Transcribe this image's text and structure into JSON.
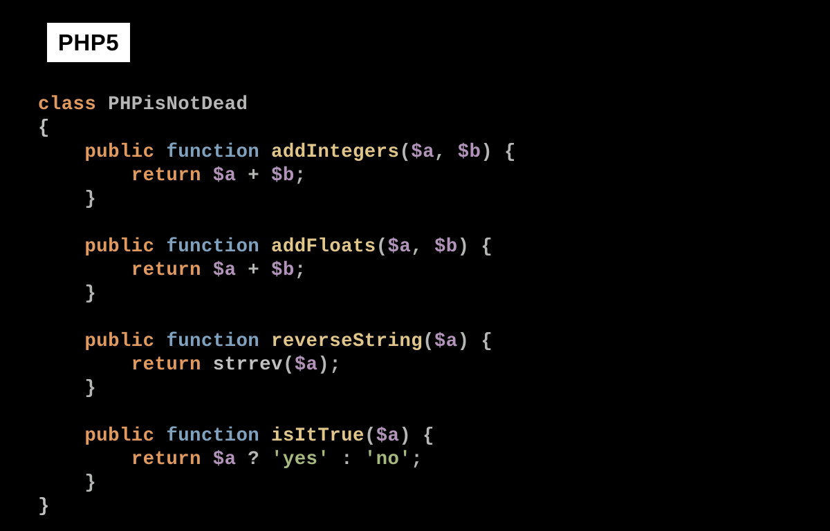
{
  "badge": "PHP5",
  "colors": {
    "background": "#000000",
    "keyword_orange": "#e09a5f",
    "keyword_blue": "#81a2be",
    "function_name": "#e1c68c",
    "identifier": "#b4b7b4",
    "variable": "#b294bb",
    "punctuation": "#b4b7b4",
    "text": "#bfc2bf",
    "string": "#a8b97f",
    "badge_bg": "#ffffff",
    "badge_fg": "#000000"
  },
  "code": {
    "class_kw": "class",
    "class_name": "PHPisNotDead",
    "open_brace": "{",
    "close_brace": "}",
    "public_kw": "public",
    "function_kw": "function",
    "return_kw": "return",
    "fn1_name": "addIntegers",
    "fn1_params_open": "(",
    "fn1_param_a": "$a",
    "fn1_comma": ",",
    "fn1_space": " ",
    "fn1_param_b": "$b",
    "fn1_params_close": ")",
    "fn1_body_open": " {",
    "fn1_ret_a": "$a",
    "fn1_plus": " + ",
    "fn1_ret_b": "$b",
    "fn1_semi": ";",
    "fn1_body_close": "}",
    "fn2_name": "addFloats",
    "fn2_param_a": "$a",
    "fn2_comma": ",",
    "fn2_param_b": "$b",
    "fn2_ret_a": "$a",
    "fn2_plus": " + ",
    "fn2_ret_b": "$b",
    "fn2_semi": ";",
    "fn3_name": "reverseString",
    "fn3_param_a": "$a",
    "fn3_call": "strrev",
    "fn3_call_open": "(",
    "fn3_call_arg": "$a",
    "fn3_call_close": ")",
    "fn3_semi": ";",
    "fn4_name": "isItTrue",
    "fn4_param_a": "$a",
    "fn4_ret_a": "$a",
    "fn4_q": " ? ",
    "fn4_yes": "'yes'",
    "fn4_colon": " : ",
    "fn4_no": "'no'",
    "fn4_semi": ";"
  }
}
